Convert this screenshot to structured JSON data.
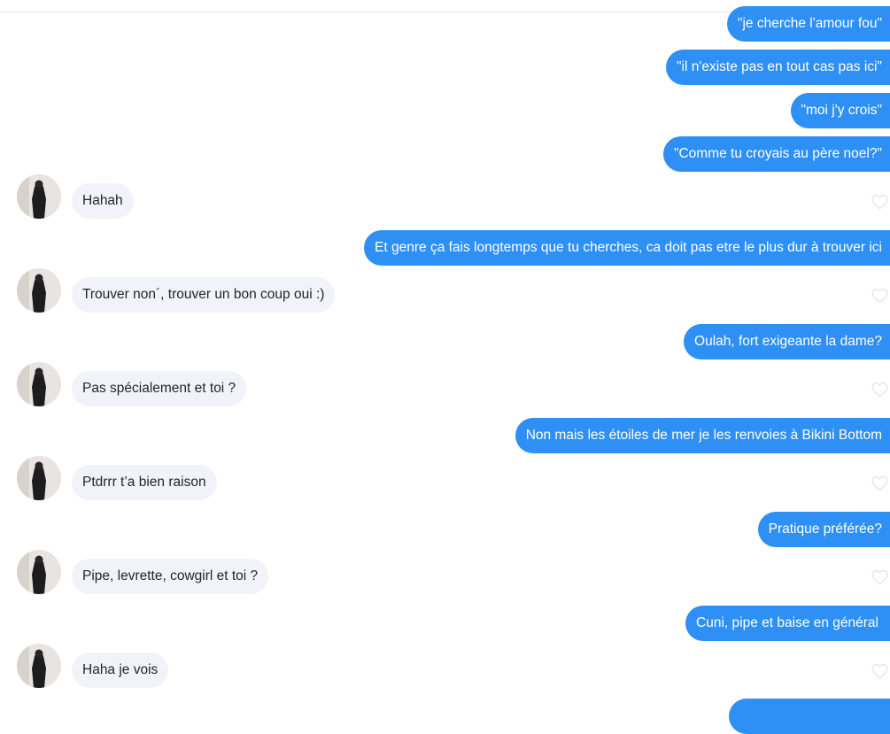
{
  "messages": [
    {
      "side": "sent",
      "text": "\"je cherche l'amour fou\""
    },
    {
      "side": "sent",
      "text": "\"il n'existe pas en tout cas pas ici\""
    },
    {
      "side": "sent",
      "text": "\"moi j'y crois\""
    },
    {
      "side": "sent",
      "text": "\"Comme tu croyais au père noel?\""
    },
    {
      "side": "received",
      "text": "Hahah"
    },
    {
      "side": "sent",
      "text": "Et genre ça fais longtemps que tu cherches, ca doit pas etre le plus dur à trouver ici"
    },
    {
      "side": "received",
      "text": "Trouver non´, trouver un bon coup oui :)"
    },
    {
      "side": "sent",
      "text": "Oulah, fort exigeante la dame?"
    },
    {
      "side": "received",
      "text": "Pas spécialement et toi ?"
    },
    {
      "side": "sent",
      "text": "Non mais les étoiles de mer je les renvoies à Bikini Bottom"
    },
    {
      "side": "received",
      "text": "Ptdrrr t’a bien raison"
    },
    {
      "side": "sent",
      "text": "Pratique préférée?"
    },
    {
      "side": "received",
      "text": "Pipe, levrette, cowgirl et toi ?"
    },
    {
      "side": "sent",
      "text": "Cuni, pipe et baise en général"
    },
    {
      "side": "received",
      "text": "Haha je vois"
    },
    {
      "side": "sent",
      "text": ""
    }
  ],
  "colors": {
    "sent_bubble": "#2e8ff5",
    "received_bubble": "#f2f3f8",
    "received_text": "#21262e",
    "heart_outline": "#e4e4e8"
  },
  "icons": {
    "like": "heart-icon",
    "avatar": "profile-photo"
  }
}
